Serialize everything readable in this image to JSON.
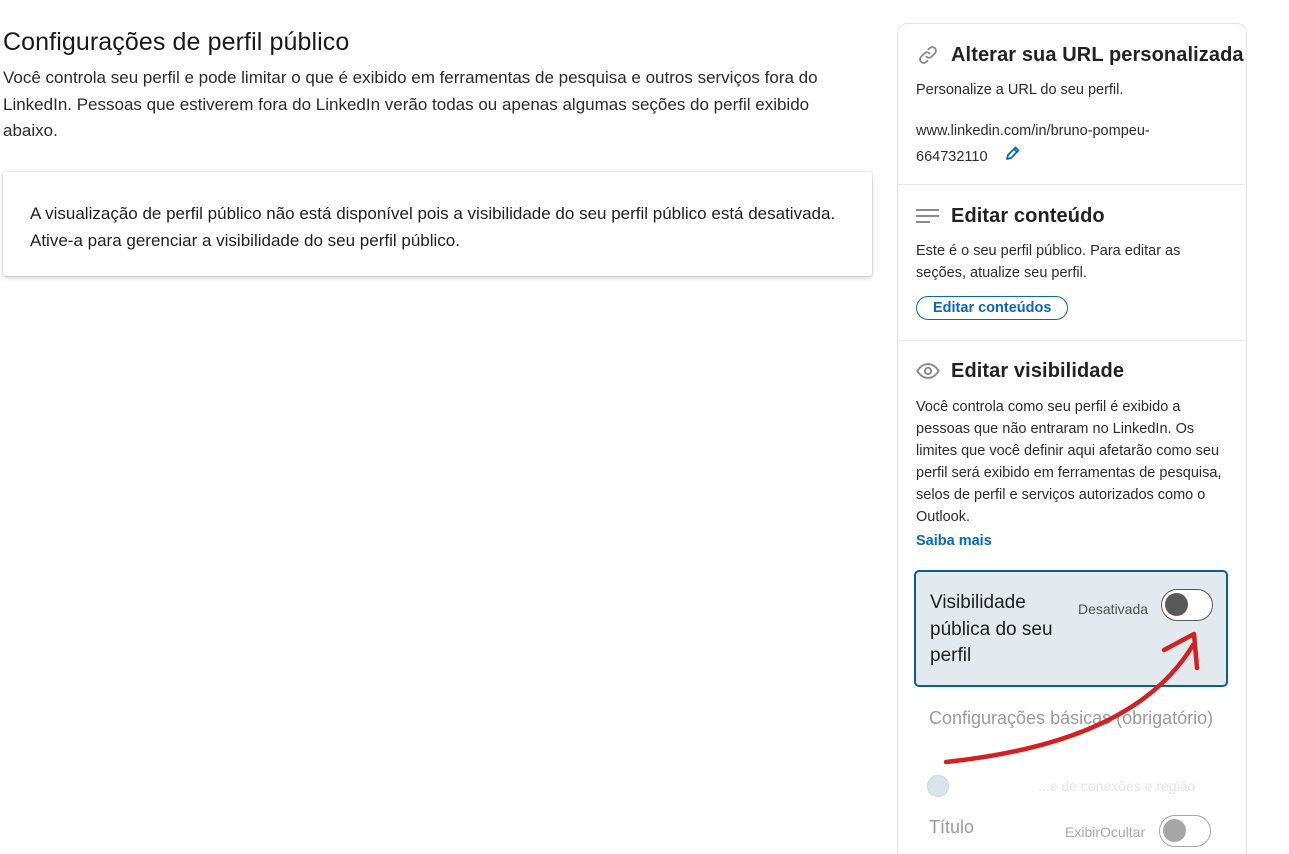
{
  "main": {
    "title": "Configurações de perfil público",
    "description": "Você controla seu perfil e pode limitar o que é exibido em ferramentas de pesquisa e outros serviços fora do LinkedIn. Pessoas que estiverem fora do LinkedIn verão todas ou apenas algumas seções do perfil exibido abaixo.",
    "notice": "A visualização de perfil público não está disponível pois a visibilidade do seu perfil público está desativada. Ative-a para gerenciar a visibilidade do seu perfil público."
  },
  "sidebar": {
    "custom_url": {
      "title": "Alterar sua URL personalizada",
      "subtitle": "Personalize a URL do seu perfil.",
      "url_line1": "www.linkedin.com/in/bruno-pompeu-",
      "url_line2": "664732110"
    },
    "edit_content": {
      "title": "Editar conteúdo",
      "text": "Este é o seu perfil público. Para editar as seções, atualize seu perfil.",
      "button": "Editar conteúdos"
    },
    "visibility": {
      "title": "Editar visibilidade",
      "text": "Você controla como seu perfil é exibido a pessoas que não entraram no LinkedIn. Os limites que você definir aqui afetarão como seu perfil será exibido em ferramentas de pesquisa, selos de perfil e serviços autorizados como o Outlook.",
      "learn_more": "Saiba mais",
      "public_visibility_label": "Visibilidade pública do seu perfil",
      "public_visibility_state": "Desativada",
      "public_visibility_on": false,
      "basic_settings": "Configurações básicas (obrigatório)",
      "basic_option": "...e de conexões e região",
      "title_row": "Título",
      "title_row_state": "ExibirOcultar"
    }
  },
  "colors": {
    "accent": "#0a66c2",
    "highlight_border": "#0c5e8f",
    "annotation_arrow": "#d42020"
  },
  "icons": [
    "link-icon",
    "pencil-icon",
    "lines-icon",
    "eye-icon"
  ]
}
